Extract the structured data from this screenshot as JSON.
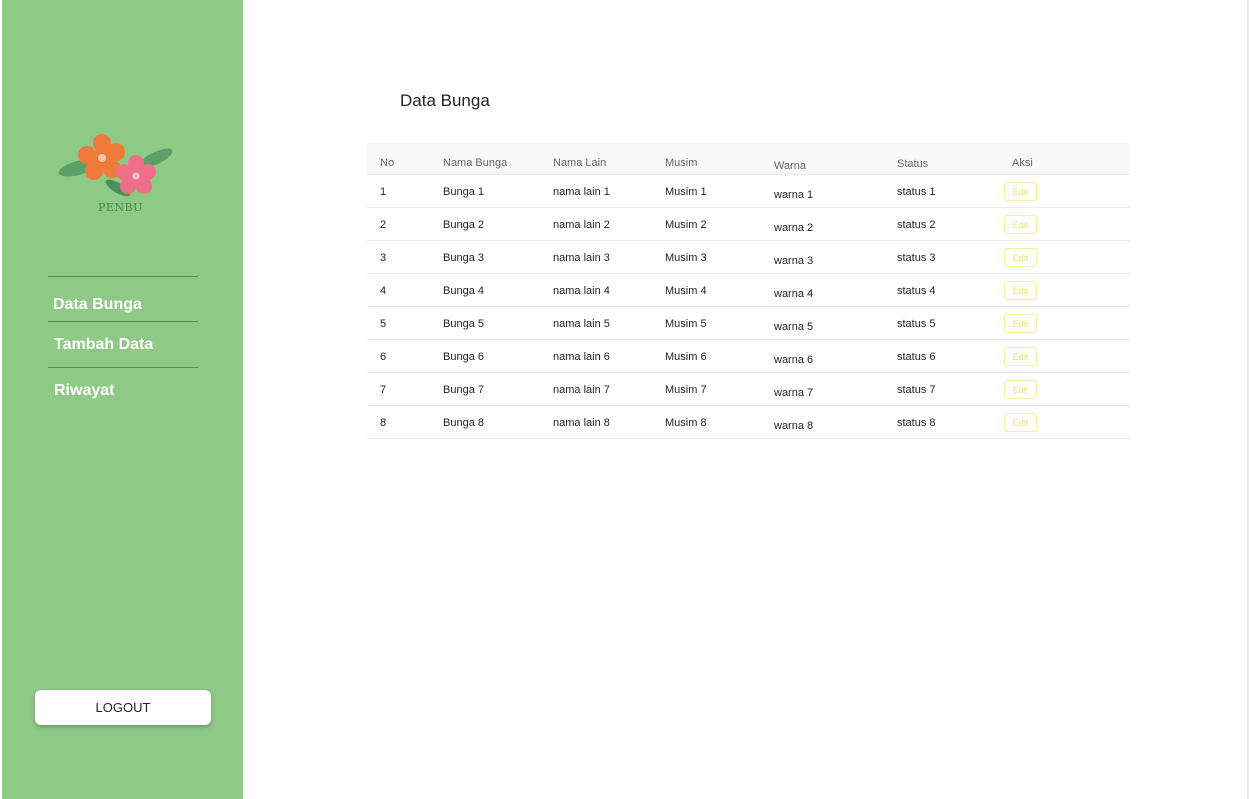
{
  "sidebar": {
    "logo_text": "PENBU",
    "nav": [
      {
        "label": "Data Bunga"
      },
      {
        "label": "Tambah Data"
      },
      {
        "label": "Riwayat"
      }
    ],
    "logout_label": "LOGOUT"
  },
  "main": {
    "title": "Data Bunga",
    "table": {
      "headers": [
        "No",
        "Nama Bunga",
        "Nama Lain",
        "Musim",
        "Warna",
        "Status",
        "Aksi"
      ],
      "action_label": "Edit",
      "rows": [
        {
          "no": "1",
          "nama": "Bunga 1",
          "lain": "nama lain 1",
          "musim": "Musim 1",
          "warna": "warna 1",
          "status": "status 1"
        },
        {
          "no": "2",
          "nama": "Bunga 2",
          "lain": "nama lain 2",
          "musim": "Musim 2",
          "warna": "warna 2",
          "status": "status 2"
        },
        {
          "no": "3",
          "nama": "Bunga 3",
          "lain": "nama lain 3",
          "musim": "Musim 3",
          "warna": "warna 3",
          "status": "status 3"
        },
        {
          "no": "4",
          "nama": "Bunga 4",
          "lain": "nama lain 4",
          "musim": "Musim 4",
          "warna": "warna 4",
          "status": "status 4"
        },
        {
          "no": "5",
          "nama": "Bunga 5",
          "lain": "nama lain 5",
          "musim": "Musim 5",
          "warna": "warna 5",
          "status": "status 5"
        },
        {
          "no": "6",
          "nama": "Bunga 6",
          "lain": "nama lain 6",
          "musim": "Musim 6",
          "warna": "warna 6",
          "status": "status 6"
        },
        {
          "no": "7",
          "nama": "Bunga 7",
          "lain": "nama lain 7",
          "musim": "Musim 7",
          "warna": "warna 7",
          "status": "status 7"
        },
        {
          "no": "8",
          "nama": "Bunga 8",
          "lain": "nama lain 8",
          "musim": "Musim 8",
          "warna": "warna 8",
          "status": "status 8"
        }
      ]
    }
  },
  "colors": {
    "sidebar": "#8fc986",
    "edit_accent": "#e8e07a"
  }
}
